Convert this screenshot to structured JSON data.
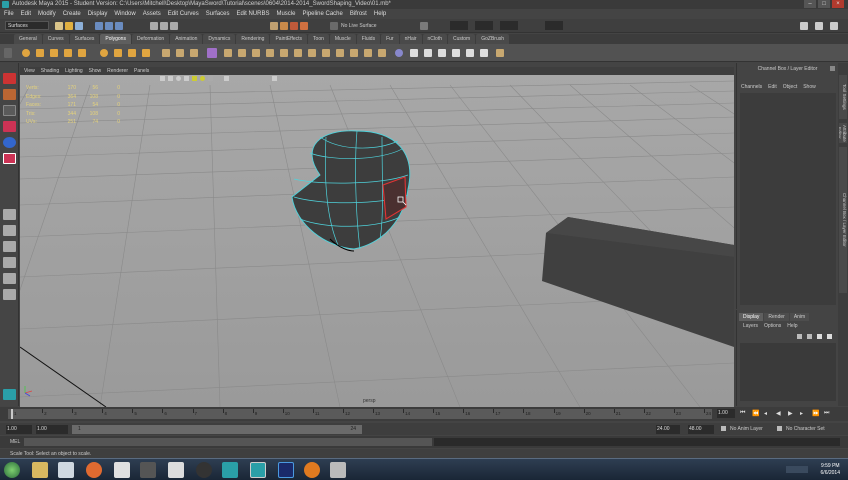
{
  "window": {
    "title": "Autodesk Maya 2015 - Student Version: C:\\Users\\Mitchell\\Desktop\\MayaSword\\Tutorial\\scenes\\0604\\2014-2014_SwordShaping_Video\\01.mb*"
  },
  "menubar": [
    "File",
    "Edit",
    "Modify",
    "Create",
    "Display",
    "Window",
    "Assets",
    "Edit Curves",
    "Surfaces",
    "Edit NURBS",
    "Muscle",
    "Pipeline Cache",
    "Bifrost",
    "Help"
  ],
  "statusline": {
    "mode": "Surfaces",
    "live_surface": "No Live Surface"
  },
  "shelf_tabs": [
    {
      "label": "General",
      "active": false
    },
    {
      "label": "Curves",
      "active": false
    },
    {
      "label": "Surfaces",
      "active": false
    },
    {
      "label": "Polygons",
      "active": true
    },
    {
      "label": "Deformation",
      "active": false
    },
    {
      "label": "Animation",
      "active": false
    },
    {
      "label": "Dynamics",
      "active": false
    },
    {
      "label": "Rendering",
      "active": false
    },
    {
      "label": "PaintEffects",
      "active": false
    },
    {
      "label": "Toon",
      "active": false
    },
    {
      "label": "Muscle",
      "active": false
    },
    {
      "label": "Fluids",
      "active": false
    },
    {
      "label": "Fur",
      "active": false
    },
    {
      "label": "nHair",
      "active": false
    },
    {
      "label": "nCloth",
      "active": false
    },
    {
      "label": "Custom",
      "active": false
    },
    {
      "label": "GoZBrush",
      "active": false
    }
  ],
  "panel_menu": [
    "View",
    "Shading",
    "Lighting",
    "Show",
    "Renderer",
    "Panels"
  ],
  "hud": [
    {
      "label": "Verts:",
      "a": "170",
      "b": "56",
      "c": "0"
    },
    {
      "label": "Edges:",
      "a": "364",
      "b": "108",
      "c": "0"
    },
    {
      "label": "Faces:",
      "a": "171",
      "b": "54",
      "c": "0"
    },
    {
      "label": "Tris:",
      "a": "344",
      "b": "108",
      "c": "0"
    },
    {
      "label": "UVs:",
      "a": "251",
      "b": "74",
      "c": "0"
    }
  ],
  "viewport": {
    "camera": "persp"
  },
  "channel_box": {
    "header": "Channel Box / Layer Editor",
    "menu": [
      "Channels",
      "Edit",
      "Object",
      "Show"
    ]
  },
  "layer_editor": {
    "tabs": [
      {
        "label": "Display",
        "active": true
      },
      {
        "label": "Render",
        "active": false
      },
      {
        "label": "Anim",
        "active": false
      }
    ],
    "menu": [
      "Layers",
      "Options",
      "Help"
    ]
  },
  "side_tabs": [
    "Tool Settings",
    "Attribute Editor",
    "Channel Box / Layer Editor"
  ],
  "time_slider": {
    "ticks": [
      "1",
      "2",
      "3",
      "4",
      "5",
      "6",
      "7",
      "8",
      "9",
      "10",
      "11",
      "12",
      "13",
      "14",
      "15",
      "16",
      "17",
      "18",
      "19",
      "20",
      "21",
      "22",
      "23",
      "24"
    ],
    "current_frame": "1.00"
  },
  "range_slider": {
    "start": "1.00",
    "inner_start": "1.00",
    "range_start_marker": "1",
    "range_end_marker": "24",
    "end": "24.00",
    "outer_end": "48.00",
    "anim_layer": "No Anim Layer",
    "character_set": "No Character Set"
  },
  "command_line": {
    "label": "MEL"
  },
  "help_line": "Scale Tool: Select an object to scale.",
  "clock": {
    "time": "9:59 PM",
    "date": "6/6/2014"
  }
}
